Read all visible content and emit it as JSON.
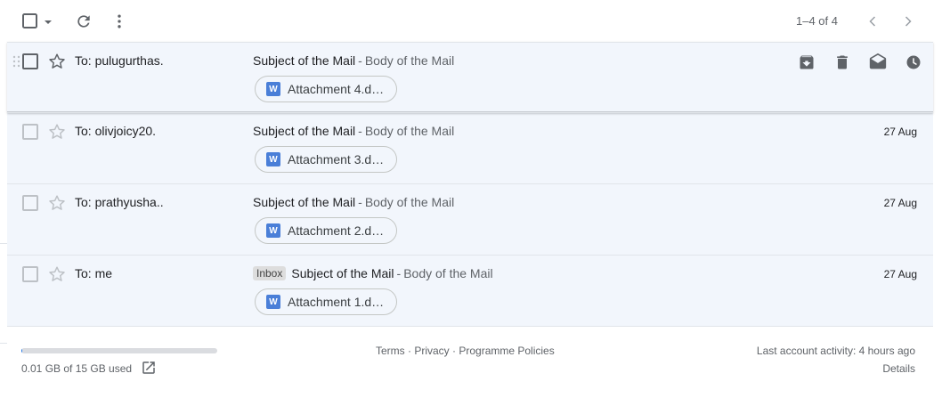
{
  "toolbar": {
    "pager_text": "1–4 of 4"
  },
  "emails": [
    {
      "to": "To: pulugurthas.",
      "label": "",
      "subject": "Subject of the Mail",
      "separator": " - ",
      "body": "Body of the Mail",
      "date": "",
      "attachment": "Attachment 4.d…"
    },
    {
      "to": "To: olivjoicy20.",
      "label": "",
      "subject": "Subject of the Mail",
      "separator": " - ",
      "body": "Body of the Mail",
      "date": "27 Aug",
      "attachment": "Attachment 3.d…"
    },
    {
      "to": "To: prathyusha..",
      "label": "",
      "subject": "Subject of the Mail",
      "separator": " - ",
      "body": "Body of the Mail",
      "date": "27 Aug",
      "attachment": "Attachment 2.d…"
    },
    {
      "to": "To: me",
      "label": "Inbox",
      "subject": "Subject of the Mail",
      "separator": " - ",
      "body": "Body of the Mail",
      "date": "27 Aug",
      "attachment": "Attachment 1.d…"
    }
  ],
  "attachment_icon_letter": "W",
  "footer": {
    "storage_text": "0.01 GB of 15 GB used",
    "storage_fraction": 0.001,
    "link_terms": "Terms",
    "link_privacy": "Privacy",
    "link_policies": "Programme Policies",
    "link_sep": " · ",
    "activity": "Last account activity: 4 hours ago",
    "details": "Details"
  },
  "colors": {
    "row_bg": "#f2f6fc",
    "accent": "#1a73e8",
    "word_icon": "#4a7fd8"
  }
}
